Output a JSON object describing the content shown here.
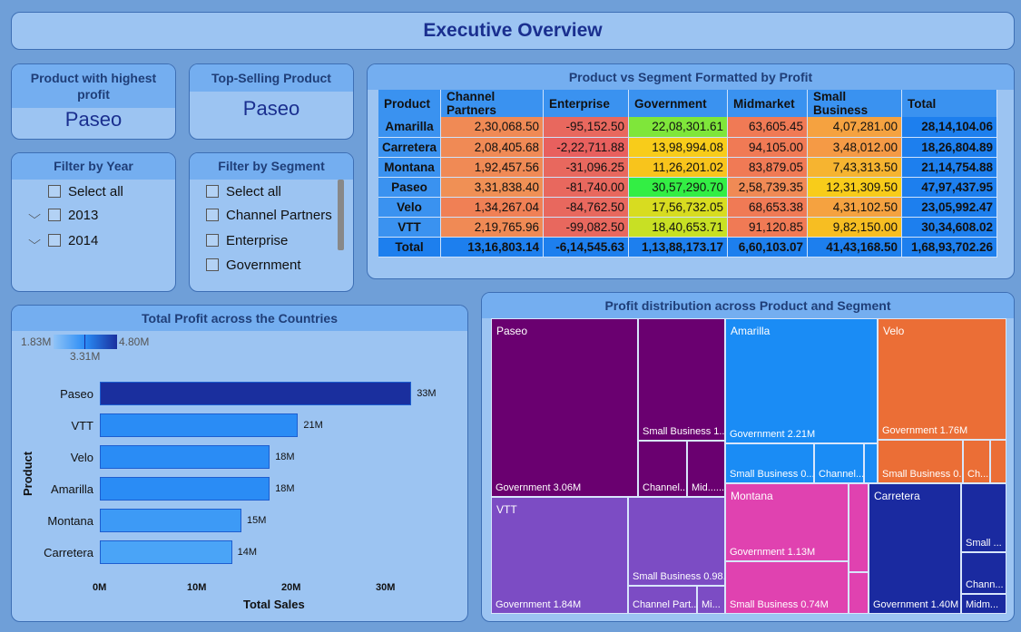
{
  "title": "Executive Overview",
  "kpi_profit": {
    "label": "Product with highest profit",
    "value": "Paseo"
  },
  "kpi_selling": {
    "label": "Top-Selling Product",
    "value": "Paseo"
  },
  "filter_year": {
    "label": "Filter by Year",
    "select_all": "Select all",
    "options": [
      "2013",
      "2014"
    ]
  },
  "filter_segment": {
    "label": "Filter by Segment",
    "select_all": "Select all",
    "options": [
      "Channel Partners",
      "Enterprise",
      "Government"
    ]
  },
  "matrix": {
    "title": "Product vs Segment Formatted by Profit",
    "columns": [
      "Product",
      "Channel Partners",
      "Enterprise",
      "Government",
      "Midmarket",
      "Small Business",
      "Total"
    ],
    "rows": [
      {
        "product": "Amarilla",
        "values": [
          "2,30,068.50",
          "-95,152.50",
          "22,08,301.61",
          "63,605.45",
          "4,07,281.00"
        ],
        "total": "28,14,104.06",
        "colors": [
          "#f08a55",
          "#e8685e",
          "#7fe63a",
          "#f07a55",
          "#f5a240"
        ]
      },
      {
        "product": "Carretera",
        "values": [
          "2,08,405.68",
          "-2,22,711.88",
          "13,98,994.08",
          "94,105.00",
          "3,48,012.00"
        ],
        "total": "18,26,804.89",
        "colors": [
          "#f08a55",
          "#e8605e",
          "#f8cc1a",
          "#f07a55",
          "#f59a45"
        ]
      },
      {
        "product": "Montana",
        "values": [
          "1,92,457.56",
          "-31,096.25",
          "11,26,201.02",
          "83,879.05",
          "7,43,313.50"
        ],
        "total": "21,14,754.88",
        "colors": [
          "#f08a55",
          "#e8685e",
          "#f8c41c",
          "#f07a55",
          "#f6b430"
        ]
      },
      {
        "product": "Paseo",
        "values": [
          "3,31,838.40",
          "-81,740.00",
          "30,57,290.70",
          "2,58,739.35",
          "12,31,309.50"
        ],
        "total": "47,97,437.95",
        "colors": [
          "#f09055",
          "#e8685e",
          "#33ee44",
          "#f08a55",
          "#f8cc1a"
        ]
      },
      {
        "product": "Velo",
        "values": [
          "1,34,267.04",
          "-84,762.50",
          "17,56,732.05",
          "68,653.38",
          "4,31,102.50"
        ],
        "total": "23,05,992.47",
        "colors": [
          "#f08055",
          "#e8685e",
          "#d8dc20",
          "#f07a55",
          "#f5a240"
        ]
      },
      {
        "product": "VTT",
        "values": [
          "2,19,765.96",
          "-99,082.50",
          "18,40,653.71",
          "91,120.85",
          "9,82,150.00"
        ],
        "total": "30,34,608.02",
        "colors": [
          "#f08a55",
          "#e8685e",
          "#c8e024",
          "#f07a55",
          "#f7be22"
        ]
      }
    ],
    "total_row": {
      "label": "Total",
      "values": [
        "13,16,803.14",
        "-6,14,545.63",
        "1,13,88,173.17",
        "6,60,103.07",
        "41,43,168.50"
      ],
      "total": "1,68,93,702.26"
    }
  },
  "bar_chart": {
    "title": "Total Profit across the Countries",
    "legend": {
      "min": "1.83M",
      "mid": "3.31M",
      "max": "4.80M"
    },
    "chart_data": {
      "type": "bar",
      "categories": [
        "Paseo",
        "VTT",
        "Velo",
        "Amarilla",
        "Montana",
        "Carretera"
      ],
      "values": [
        33,
        21,
        18,
        18,
        15,
        14
      ],
      "value_labels": [
        "33M",
        "21M",
        "18M",
        "18M",
        "15M",
        "14M"
      ],
      "colors": [
        "#1a2f9e",
        "#2a8cf5",
        "#2a8cf5",
        "#2a8cf5",
        "#3d9af6",
        "#4aa4f7"
      ],
      "xlabel": "Total Sales",
      "ylabel": "Product",
      "xticks": [
        "0M",
        "10M",
        "20M",
        "30M"
      ],
      "xlim": [
        0,
        35
      ]
    }
  },
  "treemap": {
    "title": "Profit distribution across Product and Segment",
    "tiles": {
      "paseo": {
        "label": "Paseo",
        "color": "#6a0070"
      },
      "paseo_gov": "Government 3.06M",
      "paseo_sb": "Small Business 1....",
      "paseo_ch": "Channel...",
      "paseo_mid": "Mid......",
      "vtt": {
        "label": "VTT",
        "color": "#7c4cc4"
      },
      "vtt_gov": "Government 1.84M",
      "vtt_sb": "Small Business 0.98...",
      "vtt_ch": "Channel Part...",
      "vtt_mi": "Mi...",
      "amarilla": {
        "label": "Amarilla",
        "color": "#1a8cf5"
      },
      "amarilla_gov": "Government 2.21M",
      "amarilla_sb": "Small Business 0....",
      "amarilla_ch": "Channel...",
      "velo": {
        "label": "Velo",
        "color": "#eb6e36"
      },
      "velo_gov": "Government 1.76M",
      "velo_sb": "Small Business 0....",
      "velo_ch": "Ch...",
      "montana": {
        "label": "Montana",
        "color": "#e042b0"
      },
      "montana_gov": "Government 1.13M",
      "montana_sb": "Small Business 0.74M",
      "carretera": {
        "label": "Carretera",
        "color": "#1a2aa0"
      },
      "carretera_gov": "Government 1.40M",
      "carretera_sb": "Small ...",
      "carretera_ch": "Chann...",
      "carretera_mid": "Midm..."
    }
  }
}
